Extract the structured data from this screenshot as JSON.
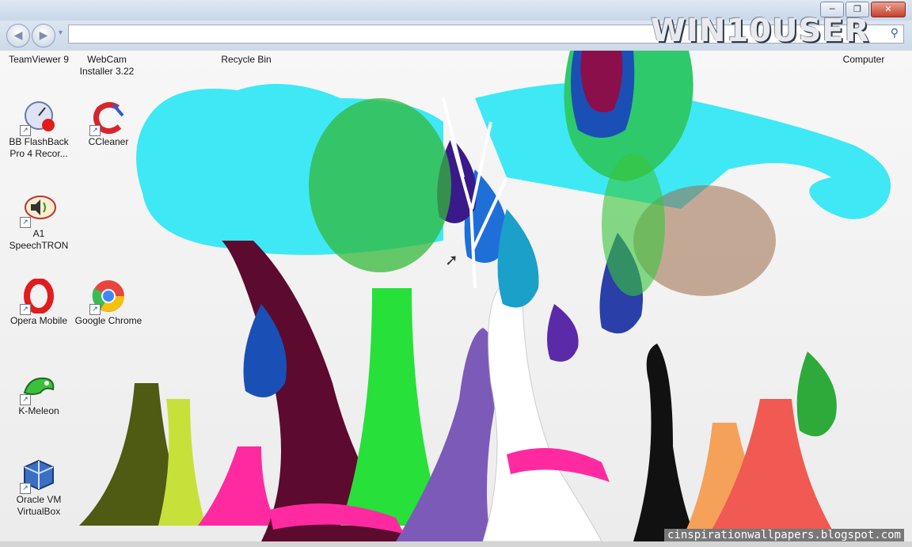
{
  "window": {
    "minimize_icon": "minimize-icon",
    "maximize_icon": "restore-icon",
    "close_icon": "close-icon",
    "minimize_glyph": "─",
    "restore_glyph": "❐",
    "close_glyph": "✕"
  },
  "navigation": {
    "back_glyph": "◀",
    "forward_glyph": "▶",
    "dropdown_glyph": "▼",
    "address_value": "",
    "search_glyph": "⚲"
  },
  "logo": {
    "text": "WIN10USER"
  },
  "desktop_icons": [
    {
      "label": "TeamViewer 9",
      "icon": "teamviewer-icon"
    },
    {
      "label": "WebCam Installer 3.22",
      "icon": "webcam-installer-icon"
    },
    {
      "label": "Recycle Bin",
      "icon": "recycle-bin-icon"
    },
    {
      "label": "Computer",
      "icon": "computer-icon"
    },
    {
      "label": "BB FlashBack Pro 4 Recor...",
      "icon": "bb-flashback-icon"
    },
    {
      "label": "CCleaner",
      "icon": "ccleaner-icon"
    },
    {
      "label": "A1 SpeechTRON",
      "icon": "speaker-icon"
    },
    {
      "label": "Opera Mobile",
      "icon": "opera-icon"
    },
    {
      "label": "Google Chrome",
      "icon": "chrome-icon"
    },
    {
      "label": "K-Meleon",
      "icon": "k-meleon-icon"
    },
    {
      "label": "Oracle VM VirtualBox",
      "icon": "virtualbox-icon"
    }
  ],
  "watermark": "cinspirationwallpapers.blogspot.com",
  "colors": {
    "sky": "#3fe8f5",
    "titlebar": "#cdd9e8",
    "close_red": "#c6402c"
  }
}
